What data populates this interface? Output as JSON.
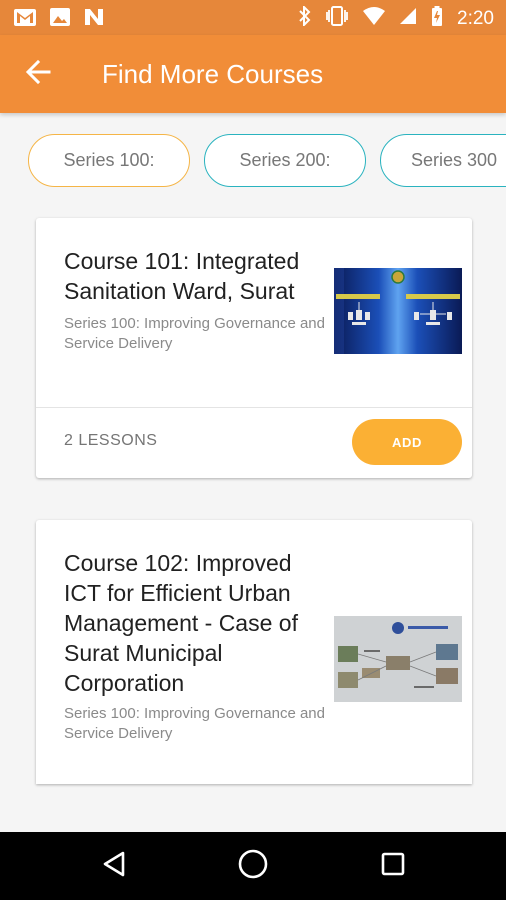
{
  "status_bar": {
    "time": "2:20",
    "left_icons": [
      "gmail-icon",
      "image-icon",
      "n-app-icon"
    ],
    "right_icons": [
      "bluetooth-icon",
      "vibrate-icon",
      "wifi-icon",
      "signal-icon",
      "battery-icon"
    ]
  },
  "app_bar": {
    "title": "Find More Courses",
    "back_icon": "arrow-back-icon",
    "color": "#f18d38"
  },
  "series_chips": [
    {
      "label": "Series 100:",
      "active": true
    },
    {
      "label": "Series 200:",
      "active": false
    },
    {
      "label": "Series 300",
      "active": false
    }
  ],
  "courses": [
    {
      "title": "Course 101: Integrated Sanitation Ward, Surat",
      "subtitle": "Series 100: Improving Governance and Service Delivery",
      "lessons": "2 LESSONS",
      "add_label": "ADD"
    },
    {
      "title": "Course 102: Improved ICT for Efficient Urban Management - Case of Surat Municipal Corporation",
      "subtitle": "Series 100: Improving Governance and Service Delivery"
    }
  ],
  "nav_bar": {
    "icons": [
      "nav-back-icon",
      "nav-home-icon",
      "nav-recents-icon"
    ]
  },
  "colors": {
    "accent": "#f18d38",
    "chip_border": "#2ab3bf",
    "chip_active_border": "#f5b547",
    "add_button": "#fbb034"
  }
}
